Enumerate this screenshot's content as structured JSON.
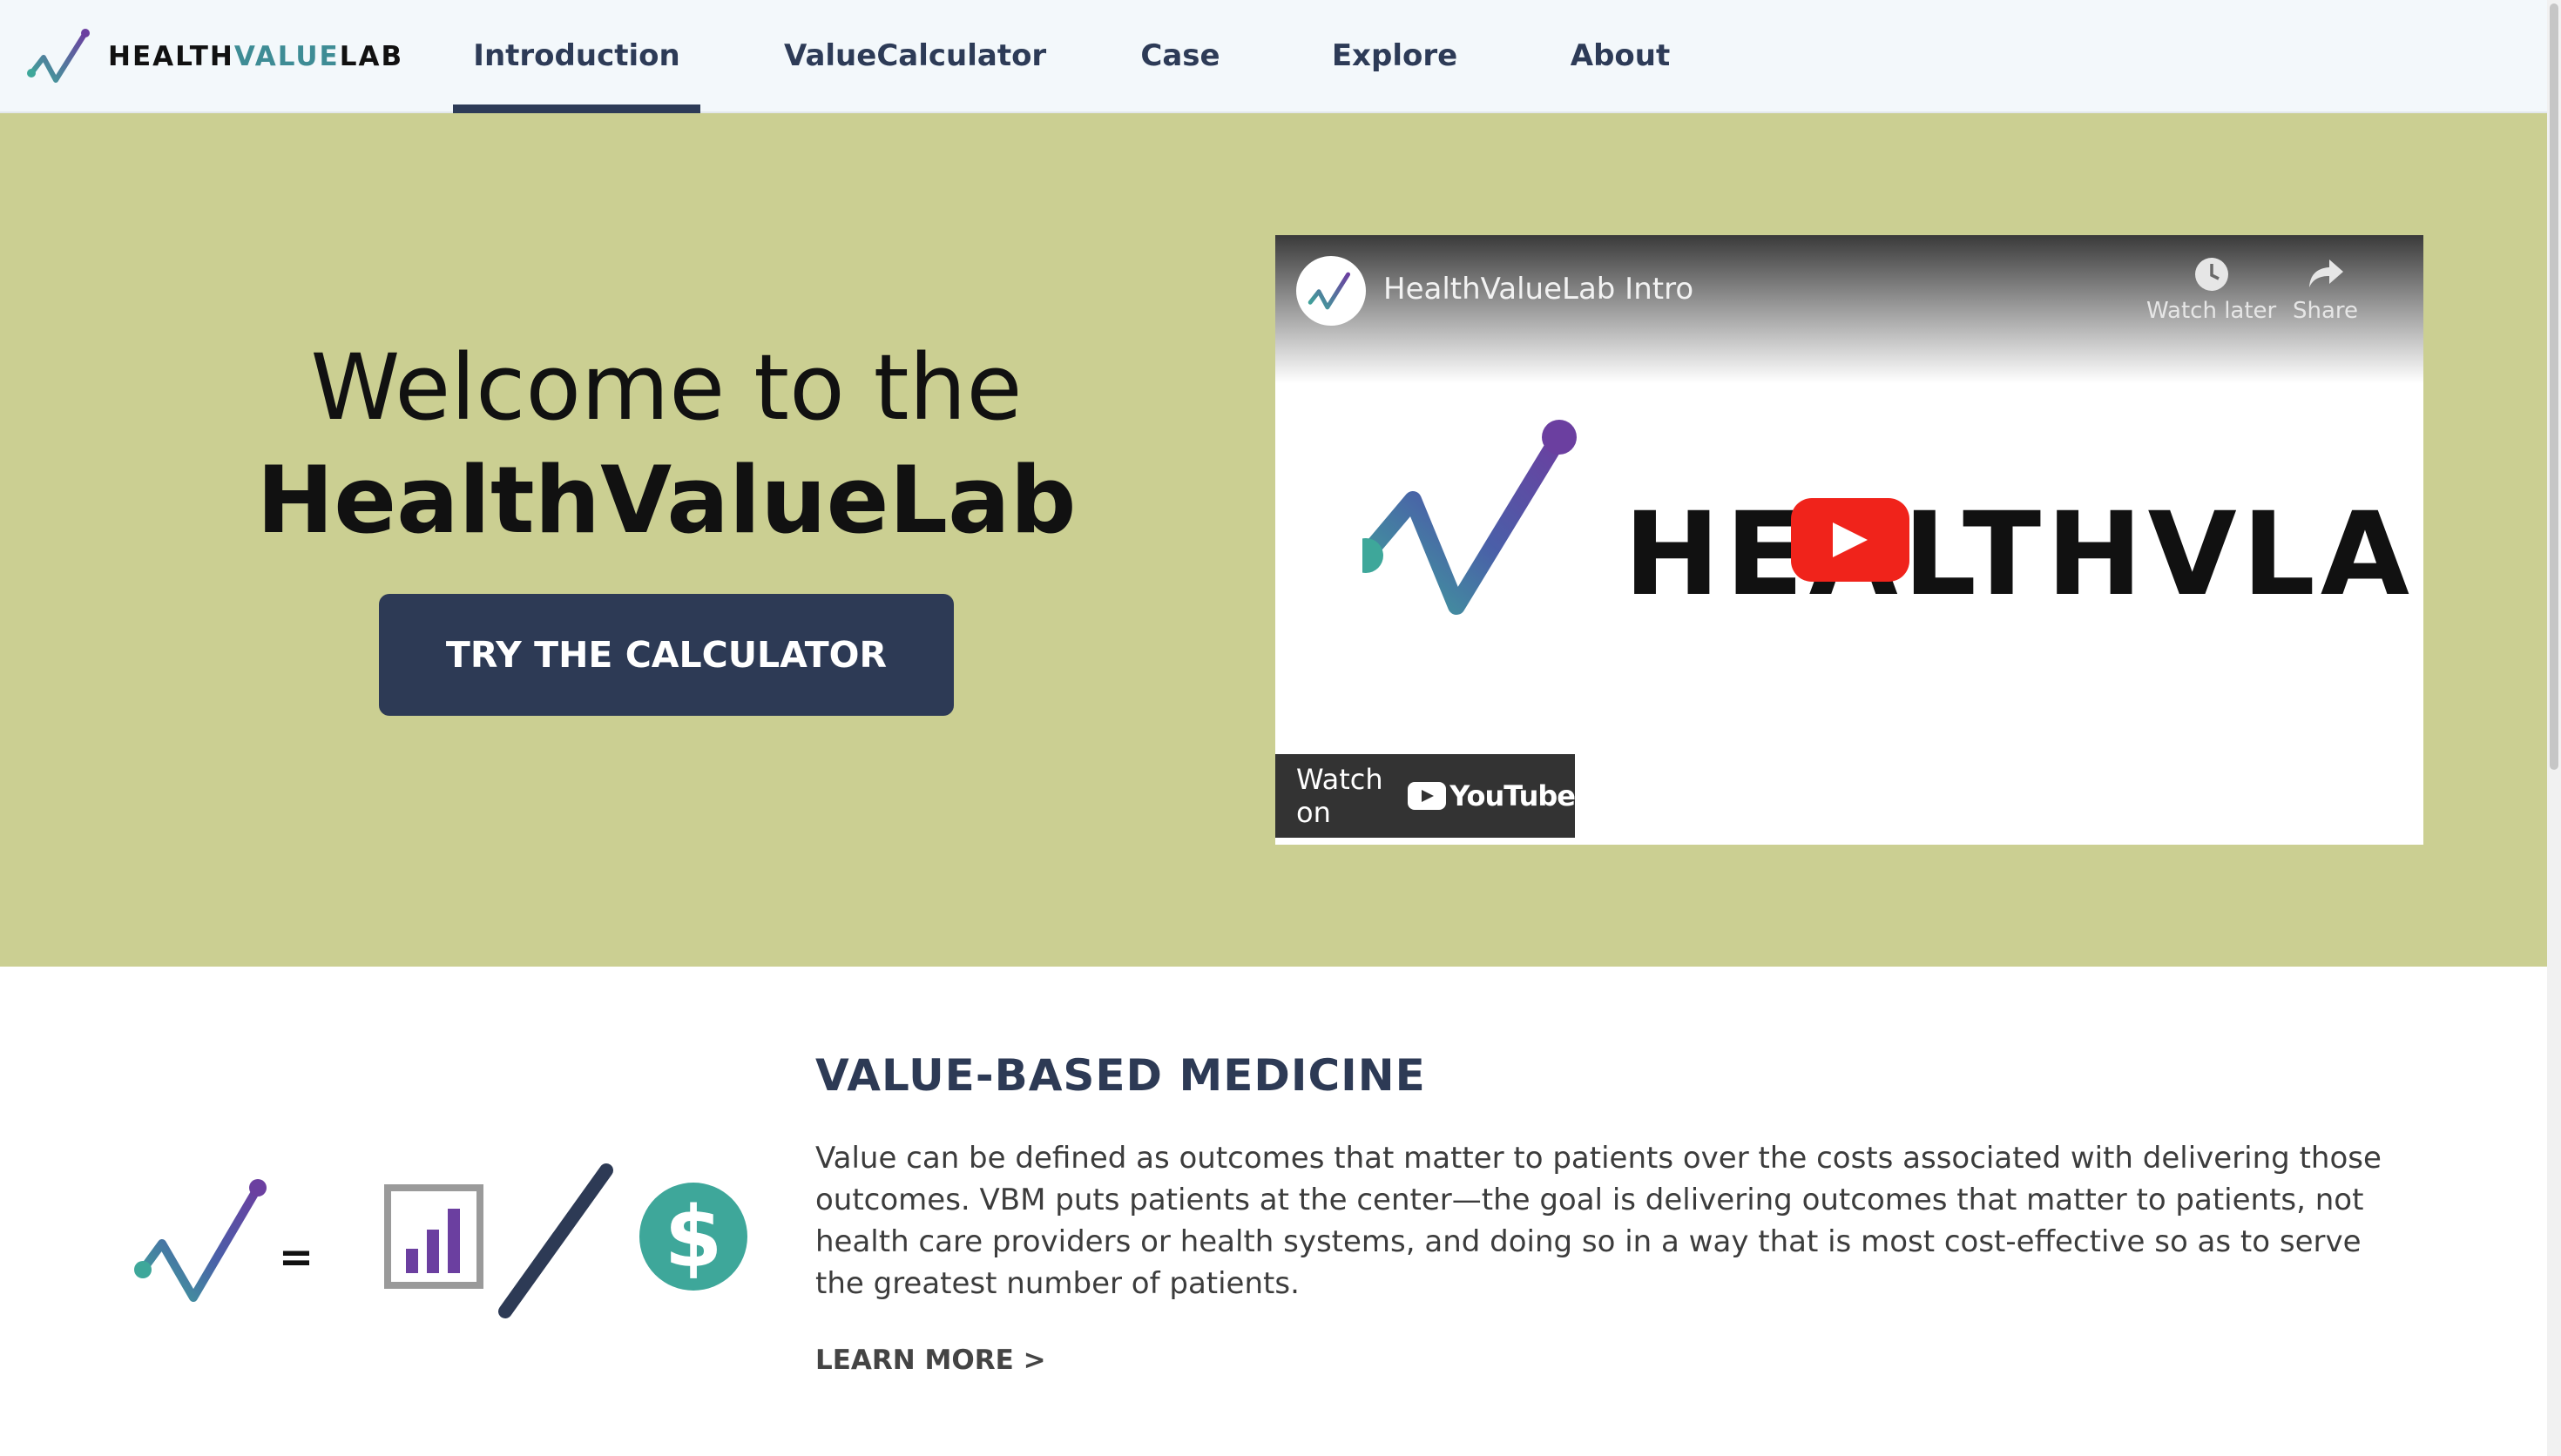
{
  "brand": {
    "part1": "HEALTH",
    "part2": "VALUE",
    "part3": "LAB"
  },
  "nav": {
    "items": [
      {
        "label": "Introduction",
        "active": true
      },
      {
        "label": "ValueCalculator",
        "active": false
      },
      {
        "label": "Case",
        "active": false
      },
      {
        "label": "Explore",
        "active": false
      },
      {
        "label": "About",
        "active": false
      }
    ]
  },
  "hero": {
    "line1": "Welcome to the",
    "line2": "HealthValueLab",
    "cta_label": "TRY THE CALCULATOR",
    "background": "#cbcf92"
  },
  "video": {
    "title": "HealthValueLab Intro",
    "watch_later_label": "Watch later",
    "share_label": "Share",
    "logo_text": "HEALTHVLAB",
    "watch_on_label": "Watch on",
    "youtube_label": "YouTube"
  },
  "value_section": {
    "title": "VALUE-BASED MEDICINE",
    "body": "Value can be defined as outcomes that matter to patients over the costs associated with delivering those outcomes. VBM puts patients at the center—the goal is delivering outcomes that matter to patients, not health care providers or health systems, and doing so in a way that is most cost-effective so as to serve the greatest number of patients.",
    "learn_more_label": "LEARN MORE >",
    "equals_sign": "=",
    "dollar_sign": "$"
  },
  "colors": {
    "nav_text": "#2d3b57",
    "accent_teal": "#3ea79a",
    "accent_purple": "#6b3fa0",
    "button": "#2d3a55"
  }
}
